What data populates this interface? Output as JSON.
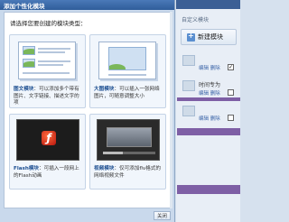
{
  "background": {
    "title": "自定义模块",
    "new_button": "新建模块",
    "rows": [
      {
        "title": "",
        "edit": "编辑",
        "delete": "删除",
        "checked": true
      },
      {
        "title": "时间专为",
        "edit": "编辑",
        "delete": "删除",
        "checked": false
      },
      {
        "title": "",
        "edit": "编辑",
        "delete": "删除",
        "checked": false
      }
    ]
  },
  "dialog": {
    "title": "添加个性化模块",
    "prompt": "请选择您要创建的模块类型：",
    "cards": [
      {
        "name": "图文模块",
        "text": "：可以添加多个带有图片、文字链接、描述文字的项"
      },
      {
        "name": "大图模块",
        "text": "：可以插入一张网络图片，可随意调整大小"
      },
      {
        "name": "Flash模块",
        "text": "：可插入一段网上的Flash动画"
      },
      {
        "name": "视频模块",
        "text": "：仅可添加flv格式的网络视频文件"
      }
    ],
    "close_label": "关闭"
  },
  "colors": {
    "titlebar": "#2f5d9a",
    "accent_text": "#1d4f91",
    "side_purple": "#7e5fa5"
  }
}
